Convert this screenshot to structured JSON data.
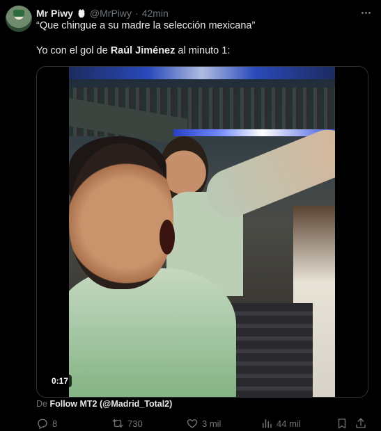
{
  "tweet": {
    "name": "Mr Piwy",
    "handle": "@MrPiwy",
    "separator": "·",
    "time": "42min",
    "text_line1": "“Que chingue a su madre la selección mexicana”",
    "text_line2_prefix": "Yo con el gol de ",
    "text_line2_bold": "Raúl Jiménez",
    "text_line2_suffix": " al minuto 1:"
  },
  "media": {
    "duration": "0:17"
  },
  "source": {
    "prefix": "De ",
    "account": "Follow MT2 (@Madrid_Total2)"
  },
  "actions": {
    "replies": "8",
    "reposts": "730",
    "likes": "3 mil",
    "views": "44 mil"
  },
  "icons": {
    "reply": "reply-icon",
    "repost": "repost-icon",
    "like": "heart-icon",
    "views": "views-icon",
    "bookmark": "bookmark-icon",
    "share": "share-icon",
    "more": "more-icon",
    "badge": "egg-emoji-icon"
  },
  "colors": {
    "background": "#000000",
    "primary_text": "#e7e9ea",
    "secondary_text": "#71767b",
    "border": "#2f3336"
  }
}
